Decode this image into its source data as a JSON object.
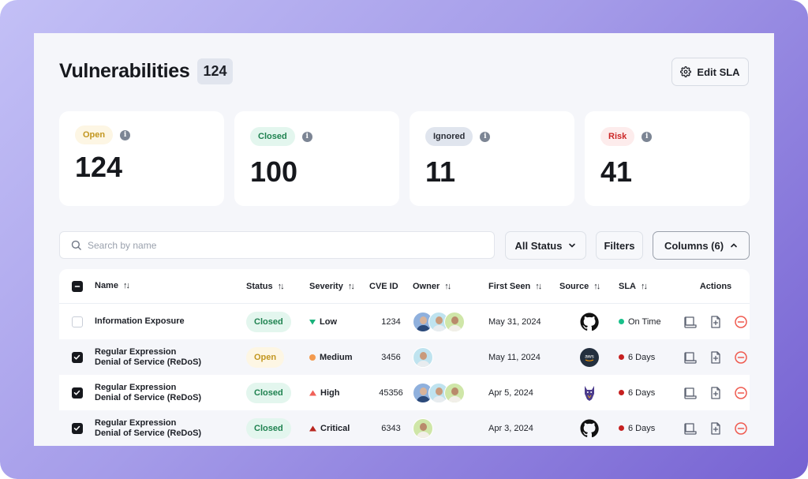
{
  "header": {
    "title": "Vulnerabilities",
    "count": "124",
    "edit_sla_label": "Edit SLA"
  },
  "cards": [
    {
      "label": "Open",
      "value": "124",
      "info": "i"
    },
    {
      "label": "Closed",
      "value": "100",
      "info": "i"
    },
    {
      "label": "Ignored",
      "value": "11",
      "info": "i"
    },
    {
      "label": "Risk",
      "value": "41",
      "info": "i"
    }
  ],
  "toolbar": {
    "search_placeholder": "Search by name",
    "search_value": "",
    "status_select": "All Status",
    "filters_label": "Filters",
    "columns_label": "Columns (6)"
  },
  "table": {
    "columns": [
      "Name",
      "Status",
      "Severity",
      "CVE ID",
      "Owner",
      "First Seen",
      "Source",
      "SLA",
      "Actions"
    ],
    "rows": [
      {
        "checked": false,
        "name_line1": "Information Exposure",
        "name_line2": "",
        "status": "Closed",
        "severity": "Low",
        "cve_id": "1234",
        "owners": [
          "man-grey-hair",
          "man-beard",
          "woman-long-hair"
        ],
        "first_seen": "May 31, 2024",
        "source": "github",
        "sla": "On Time",
        "sla_state": "on-time"
      },
      {
        "checked": true,
        "name_line1": "Regular Expression",
        "name_line2": "Denial of Service (ReDoS)",
        "status": "Open",
        "severity": "Medium",
        "cve_id": "3456",
        "owners": [
          "man-beard"
        ],
        "first_seen": "May 11, 2024",
        "source": "aws",
        "sla": "6 Days",
        "sla_state": "overdue"
      },
      {
        "checked": true,
        "name_line1": "Regular Expression",
        "name_line2": "Denial of Service (ReDoS)",
        "status": "Closed",
        "severity": "High",
        "cve_id": "45356",
        "owners": [
          "man-grey-hair",
          "man-beard",
          "woman-long-hair"
        ],
        "first_seen": "Apr 5, 2024",
        "source": "snyk",
        "sla": "6 Days",
        "sla_state": "overdue"
      },
      {
        "checked": true,
        "name_line1": "Regular Expression",
        "name_line2": "Denial of Service (ReDoS)",
        "status": "Closed",
        "severity": "Critical",
        "cve_id": "6343",
        "owners": [
          "woman-long-hair"
        ],
        "first_seen": "Apr 3, 2024",
        "source": "github",
        "sla": "6 Days",
        "sla_state": "overdue"
      }
    ],
    "actions": [
      "view-log-icon",
      "add-document-icon",
      "remove-icon"
    ]
  },
  "colors": {
    "open_bg": "#fdf6e4",
    "open_fg": "#c2961f",
    "closed_bg": "#e3f6ee",
    "closed_fg": "#1f8250",
    "ignored_bg": "#e0e5ee",
    "ignored_fg": "#2b2f38",
    "risk_bg": "#fdecec",
    "risk_fg": "#cc2727",
    "low": "#19b27b",
    "medium": "#f39a4e",
    "high": "#f06158",
    "critical": "#b8261f",
    "on_time": "#19c08a",
    "overdue": "#c62020",
    "remove": "#ef5a4f"
  }
}
